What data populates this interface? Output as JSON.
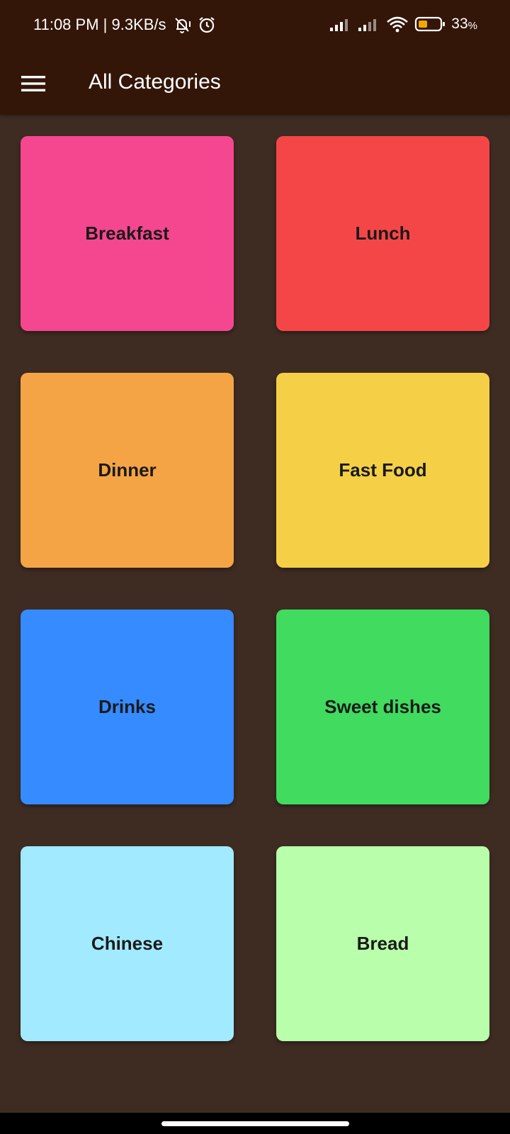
{
  "status": {
    "time_speed": "11:08 PM | 9.3KB/s",
    "battery": "33",
    "battery_unit": "%",
    "icons": [
      "bell-off-icon",
      "alarm-icon",
      "signal-1-icon",
      "signal-2-icon",
      "wifi-icon",
      "battery-icon"
    ]
  },
  "app_bar": {
    "title": "All Categories",
    "menu_icon": "hamburger-menu-icon"
  },
  "categories": [
    {
      "label": "Breakfast",
      "color": "#f5478f"
    },
    {
      "label": "Lunch",
      "color": "#f54647"
    },
    {
      "label": "Dinner",
      "color": "#f5a445"
    },
    {
      "label": "Fast Food",
      "color": "#f5d046"
    },
    {
      "label": "Drinks",
      "color": "#358bff"
    },
    {
      "label": "Sweet dishes",
      "color": "#40db5f"
    },
    {
      "label": "Chinese",
      "color": "#a2eaff"
    },
    {
      "label": "Bread",
      "color": "#b9feab"
    }
  ]
}
